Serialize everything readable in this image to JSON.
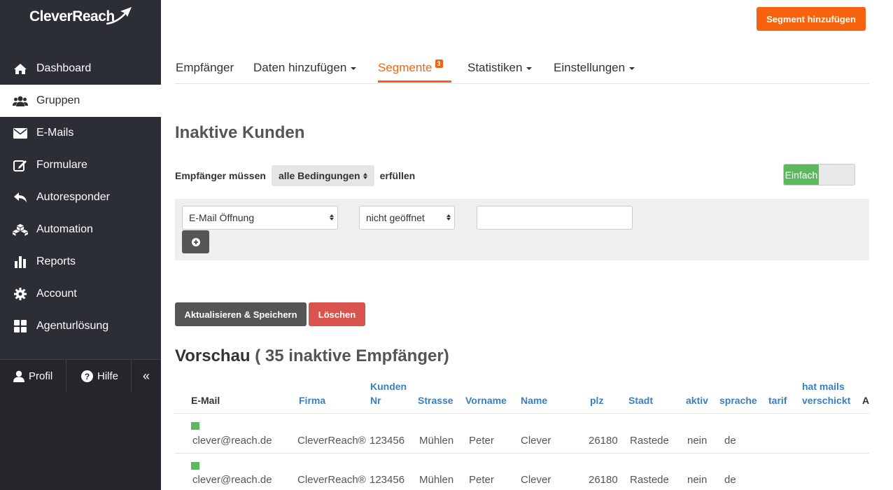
{
  "app": {
    "logo": "CleverReach"
  },
  "sidebar": {
    "items": [
      {
        "label": "Dashboard",
        "icon": "home-icon"
      },
      {
        "label": "Gruppen",
        "icon": "users-icon"
      },
      {
        "label": "E-Mails",
        "icon": "envelope-icon"
      },
      {
        "label": "Formulare",
        "icon": "edit-icon"
      },
      {
        "label": "Autoresponder",
        "icon": "reply-icon"
      },
      {
        "label": "Automation",
        "icon": "cubes-icon"
      },
      {
        "label": "Reports",
        "icon": "bar-chart-icon"
      },
      {
        "label": "Account",
        "icon": "gear-icon"
      },
      {
        "label": "Agenturlösung",
        "icon": "grid-icon"
      }
    ],
    "active_index": 1,
    "profile_label": "Profil",
    "help_label": "Hilfe",
    "collapse_glyph": "«"
  },
  "header": {
    "add_segment_label": "Segment hinzufügen"
  },
  "tabs": [
    {
      "label": "Empfänger"
    },
    {
      "label": "Daten hinzufügen"
    },
    {
      "label": "Segmente",
      "badge": "3"
    },
    {
      "label": "Statistiken"
    },
    {
      "label": "Einstellungen"
    }
  ],
  "segment": {
    "title": "Inaktive Kunden",
    "cond_prefix": "Empfänger müssen",
    "cond_select": "alle Bedingungen",
    "cond_suffix": "erfüllen",
    "mode_toggle_label": "Einfach",
    "filter_field": "E-Mail Öffnung",
    "filter_operator": "nicht geöffnet",
    "filter_value": "",
    "save_label": "Aktualisieren & Speichern",
    "delete_label": "Löschen"
  },
  "preview": {
    "title": "Vorschau",
    "count_text": "( 35 inaktive Empfänger)",
    "headers": [
      "E-Mail",
      "Firma",
      "Kunden Nr",
      "Strasse",
      "Vorname",
      "Name",
      "plz",
      "Stadt",
      "aktiv",
      "sprache",
      "tarif",
      "hat mails verschickt",
      "A"
    ],
    "rows": [
      {
        "email": "clever@reach.de",
        "firma": "CleverReach®",
        "kundennr": "123456",
        "strasse": "Mühlen",
        "vorname": "Peter",
        "name": "Clever",
        "plz": "26180",
        "stadt": "Rastede",
        "aktiv": "nein",
        "sprache": "de"
      },
      {
        "email": "clever@reach.de",
        "firma": "CleverReach®",
        "kundennr": "123456",
        "strasse": "Mühlen",
        "vorname": "Peter",
        "name": "Clever",
        "plz": "26180",
        "stadt": "Rastede",
        "aktiv": "nein",
        "sprache": "de"
      }
    ]
  },
  "colors": {
    "accent": "#f5630e",
    "sidebar": "#2b2e35",
    "success": "#5cb85c",
    "danger": "#d9534f",
    "link": "#3a7fbf"
  }
}
